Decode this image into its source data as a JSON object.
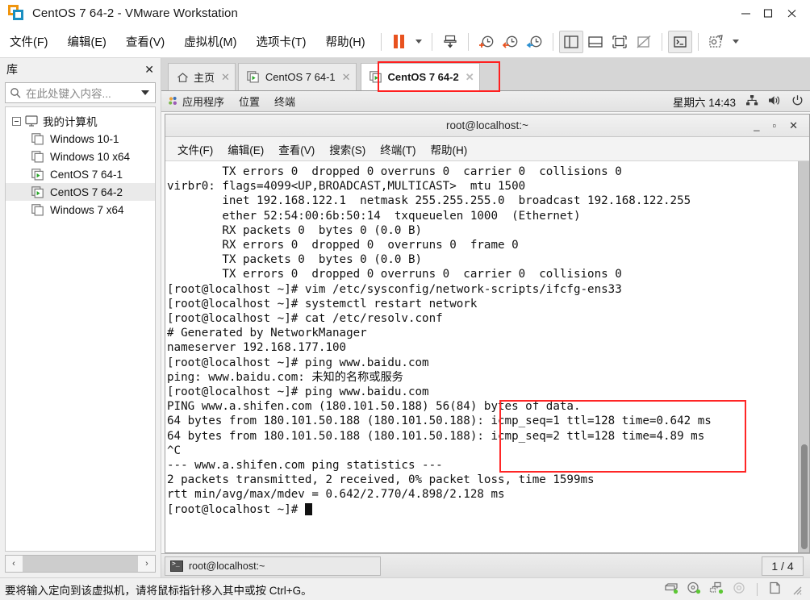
{
  "window": {
    "title": "CentOS 7 64-2 - VMware Workstation",
    "logo_colors": {
      "outer": "#f0950e",
      "inner": "#1a8fc1"
    },
    "controls": {
      "minimize": "minimize-icon",
      "maximize": "maximize-icon",
      "close": "close-icon"
    }
  },
  "menubar": {
    "items": [
      {
        "label": "文件(F)",
        "text": "文件",
        "key": "F"
      },
      {
        "label": "编辑(E)",
        "text": "编辑",
        "key": "E"
      },
      {
        "label": "查看(V)",
        "text": "查看",
        "key": "V"
      },
      {
        "label": "虚拟机(M)",
        "text": "虚拟机",
        "key": "M"
      },
      {
        "label": "选项卡(T)",
        "text": "选项卡",
        "key": "T"
      },
      {
        "label": "帮助(H)",
        "text": "帮助",
        "key": "H"
      }
    ],
    "toolbar_icons": [
      "pause-icon",
      "dropdown-caret-icon",
      "send-ctrl-alt-del-icon",
      "snapshot-take-icon",
      "snapshot-revert-icon",
      "snapshot-manager-icon",
      "show-library-icon",
      "show-thumbnail-bar-icon",
      "full-screen-icon",
      "unity-mode-icon",
      "console-view-icon",
      "stretch-guest-icon",
      "dropdown-caret-icon-2"
    ],
    "accent": "#e8521f"
  },
  "sidebar": {
    "title": "库",
    "close_label": "✕",
    "search": {
      "placeholder": "在此处键入内容...",
      "value": "",
      "icon": "search-icon",
      "dropdown_icon": "chevron-down-icon"
    },
    "tree": {
      "root": {
        "label": "我的计算机",
        "icon": "computer-icon",
        "expanded": true
      },
      "items": [
        {
          "label": "Windows 10-1",
          "icon": "vm-stopped-icon",
          "running": false,
          "selected": false
        },
        {
          "label": "Windows 10 x64",
          "icon": "vm-stopped-icon",
          "running": false,
          "selected": false
        },
        {
          "label": "CentOS 7 64-1",
          "icon": "vm-running-icon",
          "running": true,
          "selected": false
        },
        {
          "label": "CentOS 7 64-2",
          "icon": "vm-running-icon",
          "running": true,
          "selected": true
        },
        {
          "label": "Windows 7 x64",
          "icon": "vm-stopped-icon",
          "running": false,
          "selected": false
        }
      ]
    },
    "hscroll": {
      "left_arrow": "‹",
      "right_arrow": "›"
    }
  },
  "tabs": {
    "highlight_color": "#ff2020",
    "items": [
      {
        "label": "主页",
        "icon": "home-icon",
        "active": false,
        "close": "✕"
      },
      {
        "label": "CentOS 7 64-1",
        "icon": "vm-running-icon",
        "active": false,
        "close": "✕"
      },
      {
        "label": "CentOS 7 64-2",
        "icon": "vm-running-icon",
        "active": true,
        "close": "✕",
        "highlighted": true
      }
    ]
  },
  "guest": {
    "gnome_panel": {
      "menus": [
        {
          "label": "应用程序",
          "icon": "gnome-foot-icon"
        },
        {
          "label": "位置"
        },
        {
          "label": "终端"
        }
      ],
      "clock": "星期六 14:43",
      "tray_icons": [
        "network-icon",
        "volume-icon",
        "power-icon"
      ]
    },
    "terminal": {
      "title": "root@localhost:~",
      "window_buttons": {
        "minimize": "_",
        "maximize": "▫",
        "close": "✕"
      },
      "menu": [
        {
          "label": "文件(F)"
        },
        {
          "label": "编辑(E)"
        },
        {
          "label": "查看(V)"
        },
        {
          "label": "搜索(S)"
        },
        {
          "label": "终端(T)"
        },
        {
          "label": "帮助(H)"
        }
      ],
      "lines": [
        "        TX errors 0  dropped 0 overruns 0  carrier 0  collisions 0",
        "",
        "virbr0: flags=4099<UP,BROADCAST,MULTICAST>  mtu 1500",
        "        inet 192.168.122.1  netmask 255.255.255.0  broadcast 192.168.122.255",
        "        ether 52:54:00:6b:50:14  txqueuelen 1000  (Ethernet)",
        "        RX packets 0  bytes 0 (0.0 B)",
        "        RX errors 0  dropped 0  overruns 0  frame 0",
        "        TX packets 0  bytes 0 (0.0 B)",
        "        TX errors 0  dropped 0 overruns 0  carrier 0  collisions 0",
        "",
        "[root@localhost ~]# vim /etc/sysconfig/network-scripts/ifcfg-ens33",
        "[root@localhost ~]# systemctl restart network",
        "[root@localhost ~]# cat /etc/resolv.conf",
        "# Generated by NetworkManager",
        "nameserver 192.168.177.100",
        "[root@localhost ~]# ping www.baidu.com",
        "ping: www.baidu.com: 未知的名称或服务",
        "[root@localhost ~]# ping www.baidu.com",
        "PING www.a.shifen.com (180.101.50.188) 56(84) bytes of data.",
        "64 bytes from 180.101.50.188 (180.101.50.188): icmp_seq=1 ttl=128 time=0.642 ms",
        "64 bytes from 180.101.50.188 (180.101.50.188): icmp_seq=2 ttl=128 time=4.89 ms",
        "^C",
        "--- www.a.shifen.com ping statistics ---",
        "2 packets transmitted, 2 received, 0% packet loss, time 1599ms",
        "rtt min/avg/max/mdev = 0.642/2.770/4.898/2.128 ms",
        "[root@localhost ~]# "
      ],
      "prompt_cursor": true,
      "annotation_box_color": "#ff2626"
    },
    "taskbar": {
      "task_label": "root@localhost:~",
      "task_icon": "terminal-icon",
      "workspace": "1 / 4"
    }
  },
  "statusbar": {
    "message": "要将输入定向到该虚拟机，请将鼠标指针移入其中或按 Ctrl+G。",
    "icons": [
      "hard-disk-icon",
      "cd-dvd-icon",
      "network-adapter-icon",
      "sound-card-icon",
      "usb-icon",
      "resize-grip-icon"
    ]
  }
}
